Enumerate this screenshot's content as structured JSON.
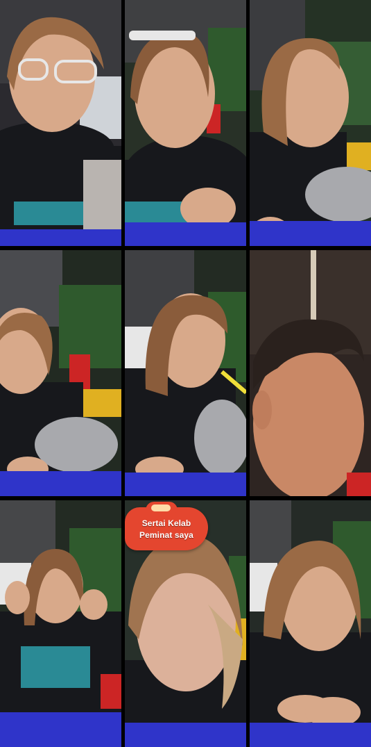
{
  "tiles": [
    {
      "id": "guest-1",
      "glasses": true
    },
    {
      "id": "guest-2",
      "glasses_on_head": true
    },
    {
      "id": "guest-3"
    },
    {
      "id": "guest-4"
    },
    {
      "id": "guest-5"
    },
    {
      "id": "guest-6"
    },
    {
      "id": "guest-7"
    },
    {
      "id": "host",
      "badge": true
    },
    {
      "id": "guest-9"
    }
  ],
  "club_badge": {
    "line1": "Sertai Kelab",
    "line2": "Peminat saya"
  },
  "colors": {
    "background": "#000000",
    "table_blue": "#2f34c9",
    "badge_red": "#e4462f",
    "hoodie": "#17181c",
    "hair": "#9a6a45",
    "skin": "#d8a98a"
  }
}
